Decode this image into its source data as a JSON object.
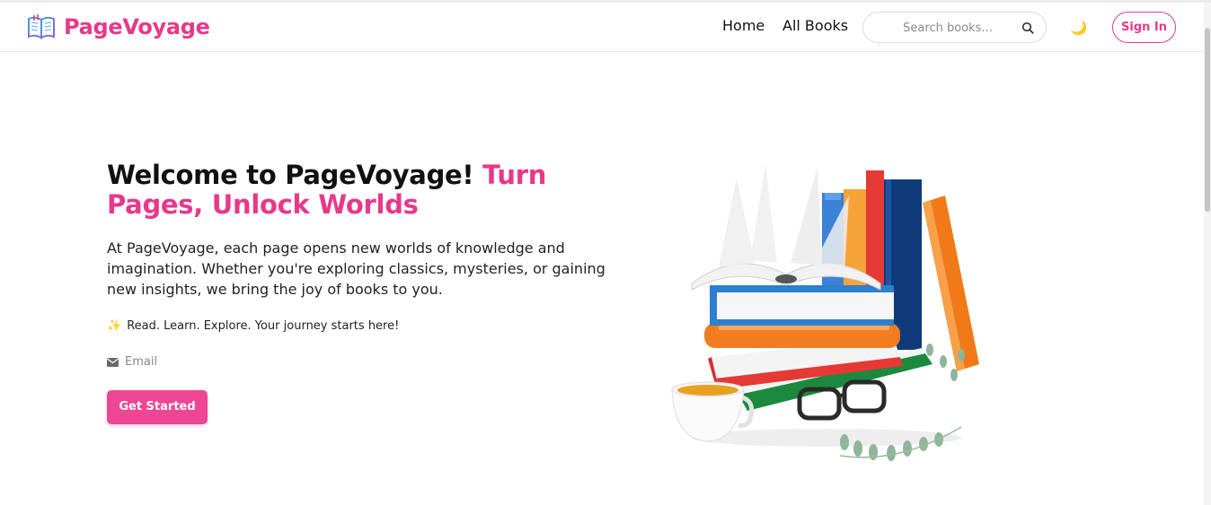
{
  "brand": {
    "name": "PageVoyage",
    "logo_icon": "open-book-icon",
    "color": "#e6398a"
  },
  "nav": {
    "home": "Home",
    "all_books": "All Books",
    "search_placeholder": "Search books...",
    "theme_icon": "moon-icon",
    "theme_glyph": "🌙",
    "sign_in": "Sign In"
  },
  "hero": {
    "title_main": "Welcome to PageVoyage! ",
    "title_accent": "Turn Pages, Unlock Worlds",
    "description": "At PageVoyage, each page opens new worlds of knowledge and imagination. Whether you're exploring classics, mysteries, or gaining new insights, we bring the joy of books to you.",
    "tagline_icon": "✨",
    "tagline": "Read. Learn. Explore. Your journey starts here!",
    "email_placeholder": "Email",
    "cta": "Get Started"
  },
  "colors": {
    "accent": "#e6398a",
    "button": "#ec4694"
  }
}
